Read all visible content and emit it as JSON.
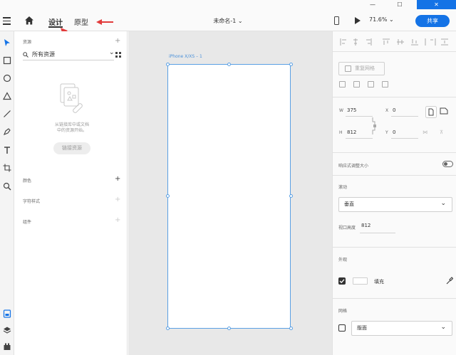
{
  "toolbar": {
    "tabs": [
      {
        "label": "设计",
        "active": true
      },
      {
        "label": "原型",
        "active": false
      }
    ],
    "document_title": "未命名-1",
    "zoom": "71.6%",
    "share_label": "共享"
  },
  "assets_panel": {
    "title": "资源",
    "filter_value": "所有资源",
    "empty_message_line1": "从链接库中或文档",
    "empty_message_line2": "中的资源开始。",
    "link_button": "链接资源",
    "sections": [
      {
        "label": "颜色"
      },
      {
        "label": "字符样式"
      },
      {
        "label": "组件"
      }
    ]
  },
  "canvas": {
    "artboard_label": "iPhone X/XS – 1"
  },
  "properties_panel": {
    "repeat_grid_label": "重复网格",
    "width_label": "W",
    "width_value": "375",
    "height_label": "H",
    "height_value": "812",
    "x_label": "X",
    "x_value": "0",
    "y_label": "Y",
    "y_value": "0",
    "responsive_resize_label": "响应式调整大小",
    "scroll_label": "滚动",
    "scroll_value": "垂直",
    "viewport_height_label": "视口高度",
    "viewport_height_value": "812",
    "appearance_label": "外观",
    "fill_label": "填充",
    "fill_checked": true,
    "fill_color": "#ffffff",
    "grid_label": "网格",
    "grid_value": "版面",
    "grid_checked": false
  },
  "colors": {
    "accent": "#1473e6",
    "selection": "#5aa0e4"
  }
}
